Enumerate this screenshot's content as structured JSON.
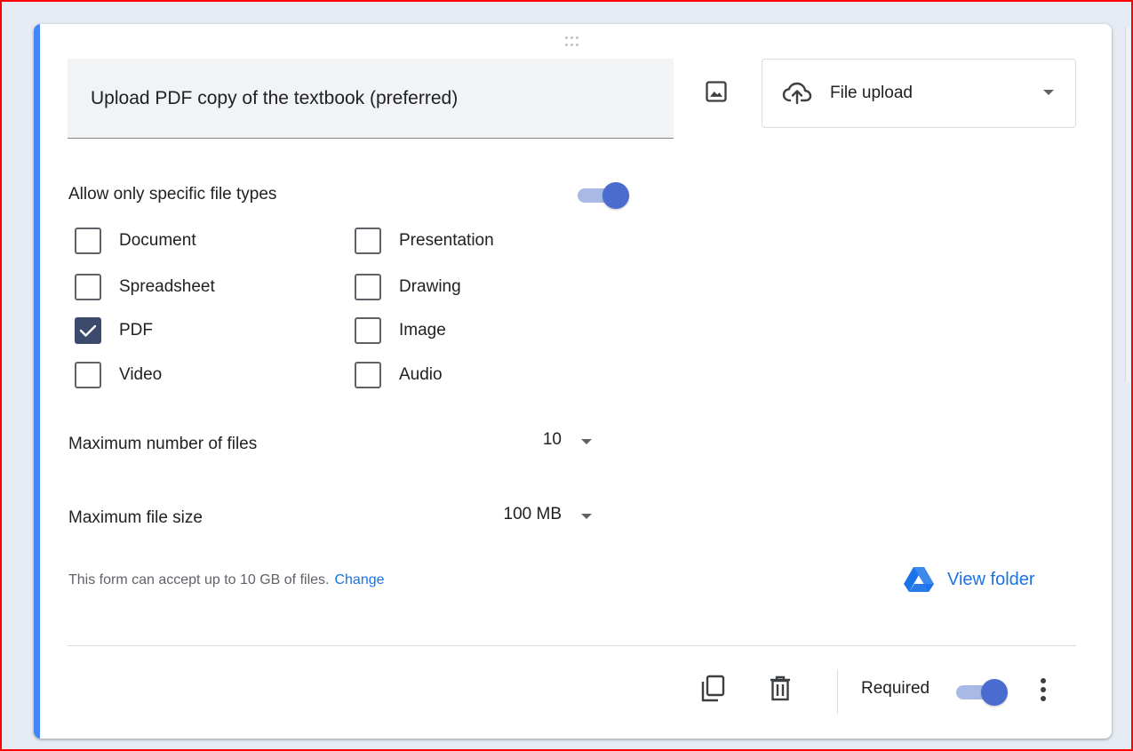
{
  "question": {
    "title": "Upload PDF copy of the textbook (preferred)",
    "type_label": "File upload"
  },
  "settings": {
    "specific_types_label": "Allow only specific file types",
    "specific_types_enabled": true,
    "file_types": [
      {
        "label": "Document",
        "checked": false
      },
      {
        "label": "Presentation",
        "checked": false
      },
      {
        "label": "Spreadsheet",
        "checked": false
      },
      {
        "label": "Drawing",
        "checked": false
      },
      {
        "label": "PDF",
        "checked": true
      },
      {
        "label": "Image",
        "checked": false
      },
      {
        "label": "Video",
        "checked": false
      },
      {
        "label": "Audio",
        "checked": false
      }
    ],
    "max_files_label": "Maximum number of files",
    "max_files_value": "10",
    "max_size_label": "Maximum file size",
    "max_size_value": "100 MB",
    "note_text": "This form can accept up to 10 GB of files.",
    "note_link": "Change",
    "view_folder_label": "View folder"
  },
  "footer": {
    "required_label": "Required",
    "required_enabled": true
  },
  "icons": {
    "drag": "drag-handle-icon",
    "image": "image-icon",
    "upload": "cloud-upload-icon",
    "drive": "google-drive-icon",
    "duplicate": "duplicate-icon",
    "delete": "trash-icon",
    "more": "more-vert-icon"
  },
  "colors": {
    "accent": "#4285f4",
    "toggle_thumb": "#4a6ccf",
    "toggle_track": "#a8b9e6",
    "checked_box": "#3c4a6e",
    "link": "#1a73e8"
  }
}
